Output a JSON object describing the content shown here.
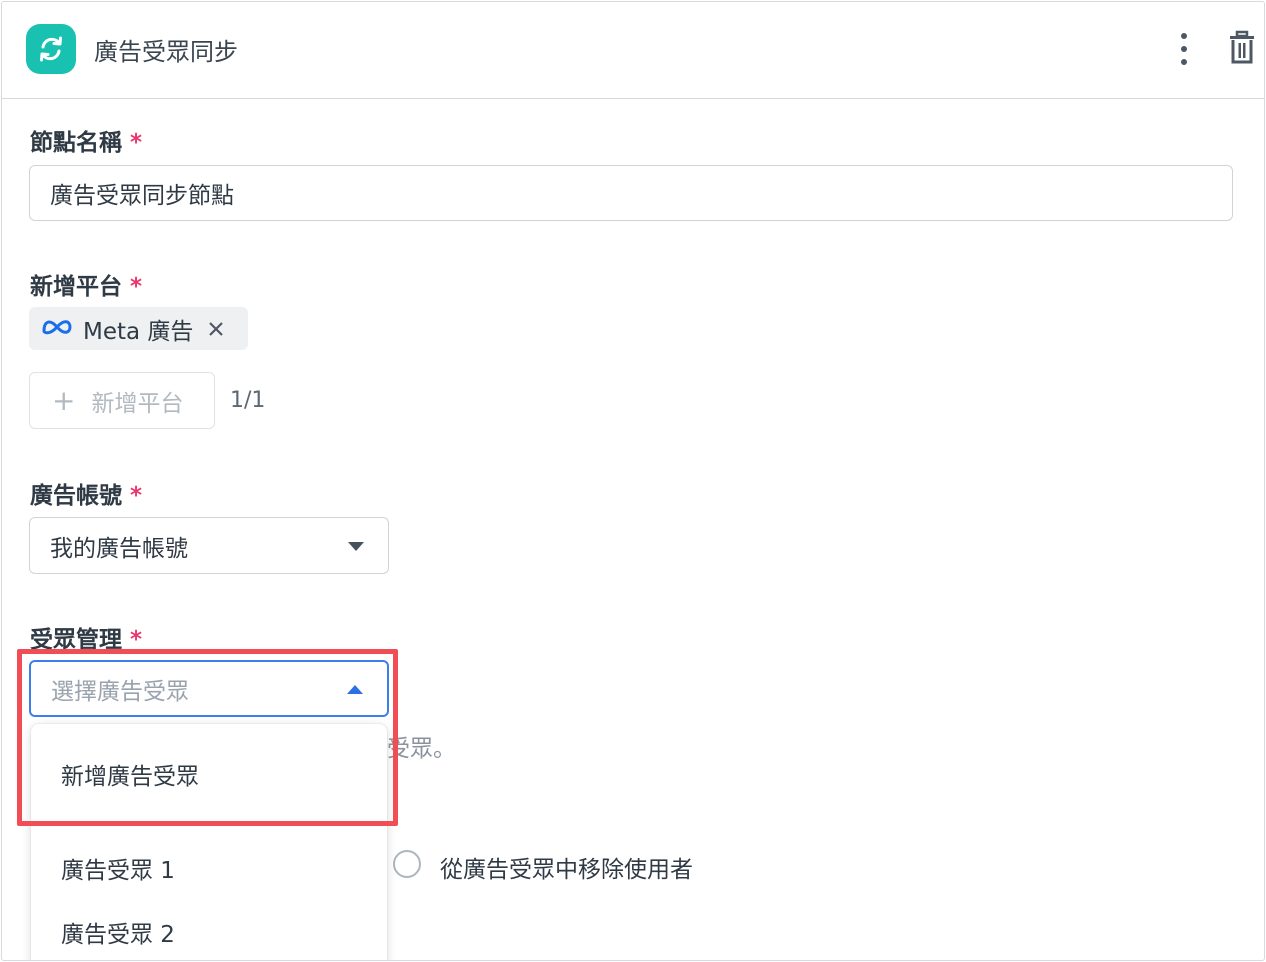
{
  "header": {
    "title": "廣告受眾同步",
    "node_icon": "sync-icon",
    "menu_icon": "kebab-menu-icon",
    "delete_icon": "trash-icon",
    "accent_color": "#19c2b0"
  },
  "form": {
    "node_name": {
      "label": "節點名稱",
      "required_mark": "*",
      "value": "廣告受眾同步節點"
    },
    "platform": {
      "label": "新增平台",
      "required_mark": "*",
      "chip_label": "Meta 廣告",
      "chip_icon": "meta-icon",
      "add_button_label": "新增平台",
      "counter": "1/1"
    },
    "ad_account": {
      "label": "廣告帳號",
      "required_mark": "*",
      "selected": "我的廣告帳號"
    },
    "audience": {
      "label": "受眾管理",
      "required_mark": "*",
      "placeholder": "選擇廣告受眾",
      "hint_partial": "受眾。",
      "dropdown_options": [
        "新增廣告受眾",
        "廣告受眾 1",
        "廣告受眾 2"
      ],
      "radio_label": "從廣告受眾中移除使用者"
    }
  },
  "colors": {
    "required": "#e8386f",
    "focus_border": "#3c7ef0",
    "highlight_box": "#f04e54"
  }
}
